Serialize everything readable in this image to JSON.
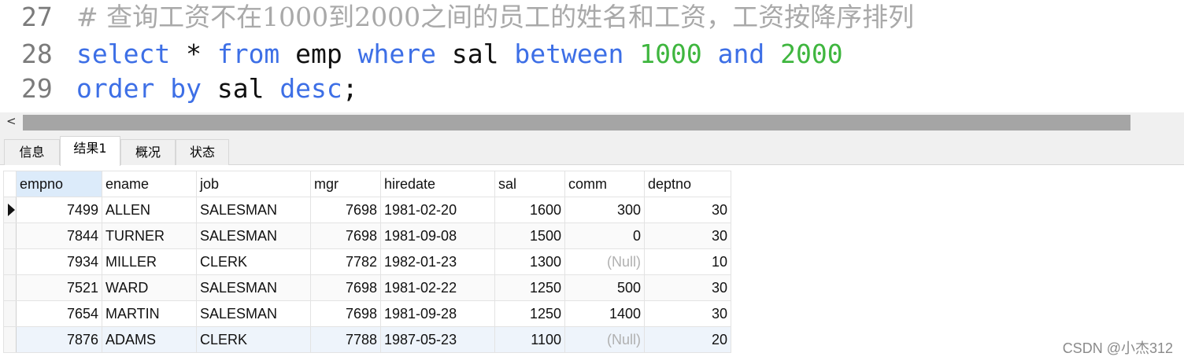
{
  "editor": {
    "lines": [
      {
        "number": "27",
        "tokens": [
          {
            "type": "comment",
            "text": "# 查询工资不在1000到2000之间的员工的姓名和工资，工资按降序排列"
          }
        ]
      },
      {
        "number": "28",
        "tokens": [
          {
            "type": "kw",
            "text": "select"
          },
          {
            "type": "id",
            "text": " * "
          },
          {
            "type": "kw",
            "text": "from"
          },
          {
            "type": "id",
            "text": " emp "
          },
          {
            "type": "kw",
            "text": "where"
          },
          {
            "type": "id",
            "text": " sal "
          },
          {
            "type": "kw",
            "text": "between"
          },
          {
            "type": "id",
            "text": " "
          },
          {
            "type": "num",
            "text": "1000"
          },
          {
            "type": "id",
            "text": " "
          },
          {
            "type": "kw",
            "text": "and"
          },
          {
            "type": "id",
            "text": " "
          },
          {
            "type": "num",
            "text": "2000"
          }
        ]
      },
      {
        "number": "29",
        "tokens": [
          {
            "type": "kw",
            "text": "order"
          },
          {
            "type": "id",
            "text": " "
          },
          {
            "type": "kw",
            "text": "by"
          },
          {
            "type": "id",
            "text": " sal "
          },
          {
            "type": "kw",
            "text": "desc"
          },
          {
            "type": "id",
            "text": ";"
          }
        ]
      }
    ]
  },
  "scrollbar": {
    "left_arrow": "<"
  },
  "tabs": [
    {
      "label": "信息",
      "active": false
    },
    {
      "label": "结果1",
      "active": true
    },
    {
      "label": "概况",
      "active": false
    },
    {
      "label": "状态",
      "active": false
    }
  ],
  "grid": {
    "columns": [
      "empno",
      "ename",
      "job",
      "mgr",
      "hiredate",
      "sal",
      "comm",
      "deptno"
    ],
    "selected_column": 0,
    "current_row": 0,
    "rows": [
      [
        "7499",
        "ALLEN",
        "SALESMAN",
        "7698",
        "1981-02-20",
        "1600",
        "300",
        "30"
      ],
      [
        "7844",
        "TURNER",
        "SALESMAN",
        "7698",
        "1981-09-08",
        "1500",
        "0",
        "30"
      ],
      [
        "7934",
        "MILLER",
        "CLERK",
        "7782",
        "1982-01-23",
        "1300",
        "(Null)",
        "10"
      ],
      [
        "7521",
        "WARD",
        "SALESMAN",
        "7698",
        "1981-02-22",
        "1250",
        "500",
        "30"
      ],
      [
        "7654",
        "MARTIN",
        "SALESMAN",
        "7698",
        "1981-09-28",
        "1250",
        "1400",
        "30"
      ],
      [
        "7876",
        "ADAMS",
        "CLERK",
        "7788",
        "1987-05-23",
        "1100",
        "(Null)",
        "20"
      ]
    ],
    "null_text": "(Null)"
  },
  "watermark": "CSDN @小杰312",
  "colors": {
    "keyword": "#3d6fe6",
    "number": "#3fb63f",
    "comment": "#a9a9a9",
    "line_number": "#7b7b7b",
    "selected_header": "#dcebfa",
    "null_value": "#b0b0b0"
  }
}
